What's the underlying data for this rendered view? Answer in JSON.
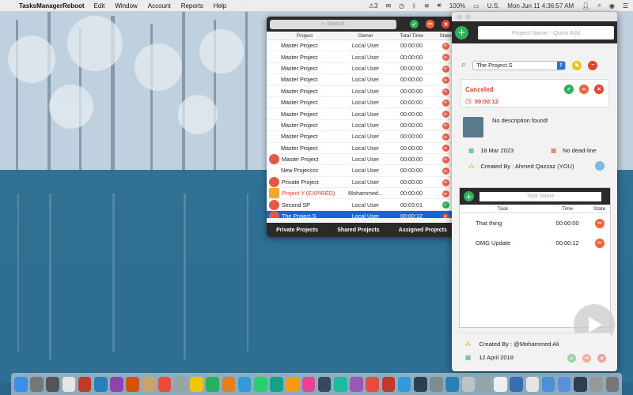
{
  "menubar": {
    "app_name": "TasksManagerReboot",
    "menus": [
      "Edit",
      "Window",
      "Account",
      "Reports",
      "Help"
    ],
    "status_badge": "3",
    "input_source": "U.S.",
    "battery": "100%",
    "clock": "Mon Jun 11  4:36:57 AM"
  },
  "popover": {
    "search_placeholder": "Search",
    "columns": {
      "project": "Project",
      "owner": "Owner",
      "time": "Total Time",
      "state": "State"
    },
    "rows": [
      {
        "name": "Master Project",
        "owner": "Local User",
        "time": "00:00:00",
        "icon": "",
        "state": "progress"
      },
      {
        "name": "Master Project",
        "owner": "Local User",
        "time": "00:00:00",
        "icon": "",
        "state": "progress"
      },
      {
        "name": "Master Project",
        "owner": "Local User",
        "time": "00:00:00",
        "icon": "",
        "state": "progress"
      },
      {
        "name": "Master Project",
        "owner": "Local User",
        "time": "00:00:00",
        "icon": "",
        "state": "progress"
      },
      {
        "name": "Master Project",
        "owner": "Local User",
        "time": "00:00:00",
        "icon": "",
        "state": "progress"
      },
      {
        "name": "Master Project",
        "owner": "Local User",
        "time": "00:00:00",
        "icon": "",
        "state": "progress"
      },
      {
        "name": "Master Project",
        "owner": "Local User",
        "time": "00:00:00",
        "icon": "",
        "state": "progress"
      },
      {
        "name": "Master Project",
        "owner": "Local User",
        "time": "00:00:00",
        "icon": "",
        "state": "progress"
      },
      {
        "name": "Master Project",
        "owner": "Local User",
        "time": "00:00:00",
        "icon": "",
        "state": "progress"
      },
      {
        "name": "Master Project",
        "owner": "Local User",
        "time": "00:00:00",
        "icon": "",
        "state": "progress"
      },
      {
        "name": "Master Project",
        "owner": "Local User",
        "time": "00:00:00",
        "icon": "cloud",
        "state": "progress"
      },
      {
        "name": "New Projecccc",
        "owner": "Local User",
        "time": "00:00:00",
        "icon": "",
        "state": "progress"
      },
      {
        "name": "Private Project",
        "owner": "Local User",
        "time": "00:00:00",
        "icon": "cloud",
        "state": "progress"
      },
      {
        "name": "Project Y (EXPIRED)",
        "owner": "Mohammed...",
        "time": "00:00:00",
        "icon": "note",
        "state": "progress",
        "expired": true
      },
      {
        "name": "Second SP",
        "owner": "Local User",
        "time": "00:03:01",
        "icon": "cloud",
        "state": "done"
      },
      {
        "name": "The Project.S",
        "owner": "Local User",
        "time": "00:00:12",
        "icon": "cloud",
        "state": "canceled",
        "selected": true
      }
    ],
    "footer_tabs": [
      "Private Projects",
      "Shared Projects",
      "Assigned Projects"
    ]
  },
  "window": {
    "quick_add_placeholder": "Project Name - Quick Add",
    "selected_project": "The Project.S",
    "status": "Canceled",
    "elapsed": "00:00:12",
    "description": "No description found!",
    "start_date": "18 Mar 2023",
    "deadline": "No dead-line",
    "created_by": "Created By : Ahmed Qazzaz (YOU)",
    "task_name_placeholder": "Task Name",
    "task_columns": {
      "task": "Task",
      "time": "Time",
      "state": "State"
    },
    "tasks": [
      {
        "name": "That thing",
        "time": "00:00:00"
      },
      {
        "name": "OMG Update",
        "time": "00:00:12"
      }
    ],
    "footer_created_by": "Created By : @Mohammed Ali",
    "footer_date": "12 April 2018"
  },
  "colors": {
    "accent_green": "#2fb05a",
    "accent_red": "#e0462f",
    "selection": "#1565d6"
  }
}
